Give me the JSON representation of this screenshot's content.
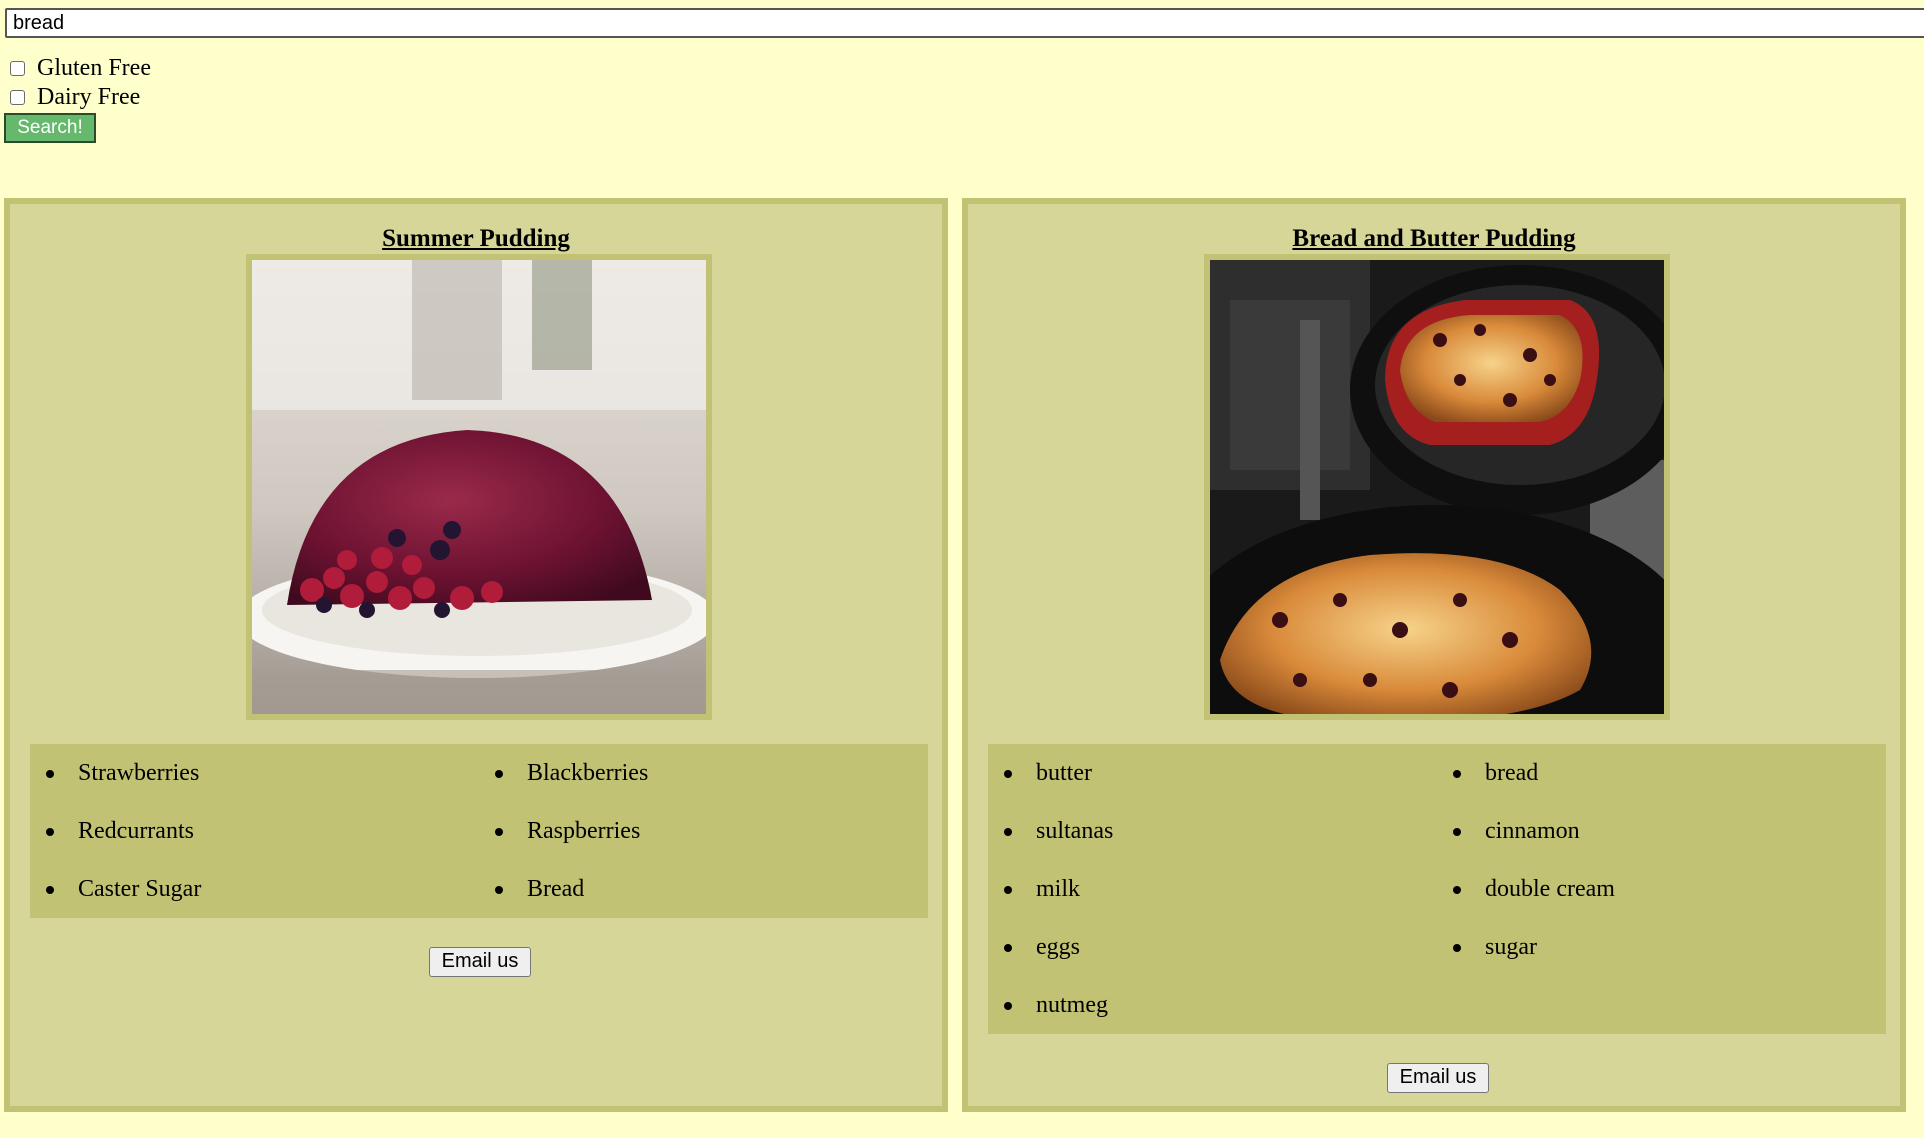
{
  "search": {
    "value": "bread"
  },
  "filters": [
    {
      "label": "Gluten Free",
      "checked": false
    },
    {
      "label": "Dairy Free",
      "checked": false
    }
  ],
  "search_button": {
    "label": "Search!"
  },
  "recipes": [
    {
      "title": "Summer Pudding",
      "image": "summer-pudding-photo",
      "ingredients": [
        "Strawberries",
        "Blackberries",
        "Redcurrants",
        "Raspberries",
        "Caster Sugar",
        "Bread"
      ],
      "email_label": "Email us"
    },
    {
      "title": "Bread and Butter Pudding",
      "image": "bread-and-butter-pudding-photo",
      "ingredients": [
        "butter",
        "bread",
        "sultanas",
        "cinnamon",
        "milk",
        "double cream",
        "eggs",
        "sugar",
        "nutmeg"
      ],
      "email_label": "Email us"
    }
  ],
  "colors": {
    "page_background": "#ffffcc",
    "card_background": "#d6d699",
    "card_border": "#c2c274",
    "search_button": "#66b86d"
  }
}
